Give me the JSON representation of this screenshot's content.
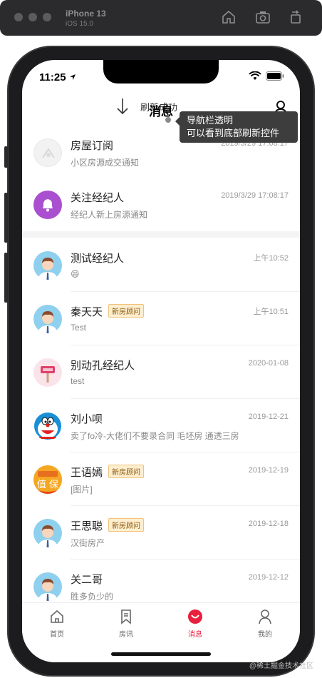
{
  "simulator": {
    "device": "iPhone 13",
    "os": "iOS 15.0"
  },
  "status_bar": {
    "time": "11:25"
  },
  "nav": {
    "refresh_text": "刷新成功",
    "title": "消息"
  },
  "tooltip": {
    "line1": "导航栏透明",
    "line2": "可以看到底部刷新控件"
  },
  "system_rows": [
    {
      "name": "房屋订阅",
      "time": "2019/3/29 17:08:17",
      "preview": "小区房源成交通知",
      "icon": "house-subscription-icon"
    },
    {
      "name": "关注经纪人",
      "time": "2019/3/29 17:08:17",
      "preview": "经纪人新上房源通知",
      "icon": "bell-icon"
    }
  ],
  "chat_rows": [
    {
      "name": "测试经纪人",
      "badge": "",
      "time": "上午10:52",
      "preview": "😄",
      "avatar": "agent-avatar"
    },
    {
      "name": "秦天天",
      "badge": "新房顾问",
      "time": "上午10:51",
      "preview": "Test",
      "avatar": "agent-avatar"
    },
    {
      "name": "别动孔经纪人",
      "badge": "",
      "time": "2020-01-08",
      "preview": "test",
      "avatar": "pink-sign-avatar"
    },
    {
      "name": "刘小呗",
      "badge": "",
      "time": "2019-12-21",
      "preview": "卖了fo冷-大佬们不要录合同 毛坯房 通透三房",
      "avatar": "doraemon-avatar"
    },
    {
      "name": "王语嫣",
      "badge": "新房顾问",
      "time": "2019-12-19",
      "preview": "[图片]",
      "avatar": "orange-avatar"
    },
    {
      "name": "王思聪",
      "badge": "新房顾问",
      "time": "2019-12-18",
      "preview": "汉街房产",
      "avatar": "agent-avatar"
    },
    {
      "name": "关二哥",
      "badge": "",
      "time": "2019-12-12",
      "preview": "胜多负少的",
      "avatar": "agent-avatar"
    }
  ],
  "tabbar": {
    "items": [
      {
        "label": "首页",
        "icon": "home-icon"
      },
      {
        "label": "房讯",
        "icon": "bookmark-icon"
      },
      {
        "label": "消息",
        "icon": "message-icon",
        "active": true
      },
      {
        "label": "我的",
        "icon": "person-icon"
      }
    ]
  },
  "colors": {
    "accent": "#e8203d",
    "badge_bg": "#fdeecf",
    "bell_bg": "#a94fd0"
  },
  "watermark": "@稀土掘金技术社区"
}
